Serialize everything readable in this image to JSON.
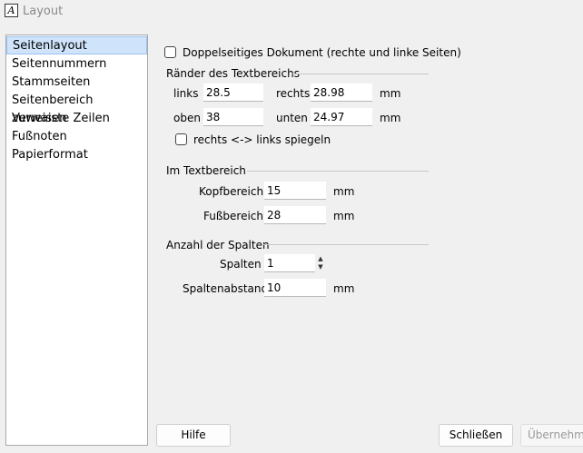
{
  "window": {
    "title": "Layout"
  },
  "sidebar": {
    "items": [
      {
        "label": "Seitenlayout",
        "selected": true
      },
      {
        "label": "Seitennummern"
      },
      {
        "label": "Stammseiten"
      },
      {
        "label": "Seitenbereich zuweisen"
      },
      {
        "label": "Verwaiste Zeilen"
      },
      {
        "label": "Fußnoten"
      },
      {
        "label": "Papierformat"
      }
    ]
  },
  "layout": {
    "double_sided": {
      "label": "Doppelseitiges Dokument (rechte und linke Seiten)",
      "checked": false
    },
    "margins": {
      "title": "Ränder des Textbereichs",
      "left_label": "links",
      "left_value": "28.5",
      "right_label": "rechts",
      "right_value": "28.98",
      "top_label": "oben",
      "top_value": "38",
      "bottom_label": "unten",
      "bottom_value": "24.97",
      "unit_row1": "mm",
      "unit_row2": "mm",
      "mirror": {
        "label": "rechts <-> links spiegeln",
        "checked": false
      }
    },
    "text_area": {
      "title": "Im Textbereich",
      "header_label": "Kopfbereich",
      "header_value": "15",
      "header_unit": "mm",
      "footer_label": "Fußbereich",
      "footer_value": "28",
      "footer_unit": "mm"
    },
    "columns": {
      "title": "Anzahl der Spalten",
      "columns_label": "Spalten",
      "columns_value": "1",
      "gap_label": "Spaltenabstand",
      "gap_value": "10",
      "gap_unit": "mm"
    }
  },
  "buttons": {
    "help": "Hilfe",
    "close": "Schließen",
    "apply": "Übernehmen"
  },
  "icons": {
    "app": "app-logo-icon",
    "spin_up": "spin-up-icon",
    "spin_down": "spin-down-icon"
  }
}
